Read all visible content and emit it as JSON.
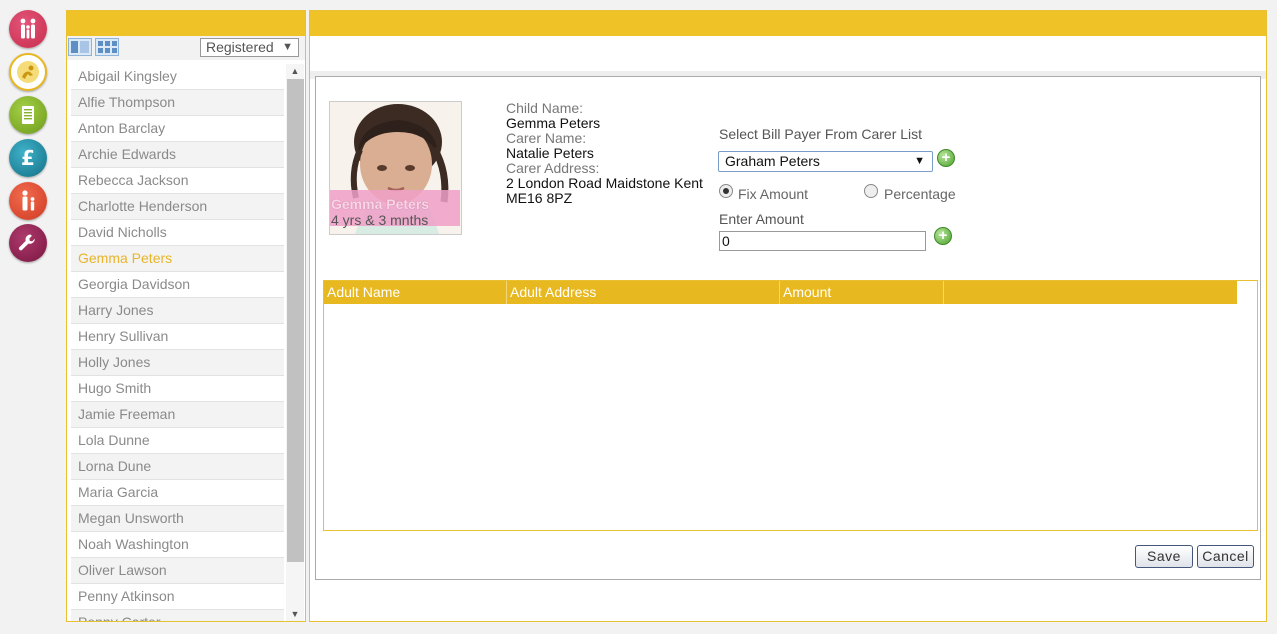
{
  "nav": {
    "icons": [
      "family-icon",
      "child-activity-icon",
      "notes-icon",
      "finance-icon",
      "parent-child-icon",
      "settings-icon"
    ],
    "colors": {
      "family": "#c82d4c",
      "activity": "#e8b820",
      "notes": "#86b12a",
      "finance": "#1b8aa3",
      "parent": "#d9432b",
      "settings": "#8a1f4e"
    }
  },
  "child_list": {
    "filter_value": "Registered",
    "children": [
      "Abigail Kingsley",
      "Alfie Thompson",
      "Anton Barclay",
      "Archie Edwards",
      "Rebecca Jackson",
      "Charlotte Henderson",
      "David Nicholls",
      "Gemma Peters",
      "Georgia Davidson",
      "Harry Jones",
      "Henry Sullivan",
      "Holly Jones",
      "Hugo Smith",
      "Jamie Freeman",
      "Lola Dunne",
      "Lorna Dune",
      "Maria Garcia",
      "Megan Unsworth",
      "Noah Washington",
      "Oliver Lawson",
      "Penny Atkinson",
      "Penny Carter"
    ],
    "selected": "Gemma Peters"
  },
  "child": {
    "photo_name": "Gemma Peters",
    "photo_age": "4 yrs & 3 mnths",
    "child_name_label": "Child Name:",
    "child_name": "Gemma Peters",
    "carer_name_label": "Carer Name:",
    "carer_name": "Natalie Peters",
    "carer_address_label": "Carer Address:",
    "carer_address_line1": "2 London Road Maidstone Kent",
    "carer_address_line2": "ME16 8PZ"
  },
  "bill_payer": {
    "label": "Select Bill Payer From Carer List",
    "selected": "Graham Peters",
    "fix_amount_label": "Fix Amount",
    "percentage_label": "Percentage",
    "mode": "Fix Amount",
    "enter_amount_label": "Enter Amount",
    "amount_value": "0"
  },
  "table": {
    "columns": [
      "Adult Name",
      "Adult Address",
      "Amount",
      ""
    ],
    "rows": []
  },
  "actions": {
    "save_label": "Save",
    "cancel_label": "Cancel"
  },
  "theme": {
    "accent": "#efc227",
    "selected_text": "#e8b52a"
  }
}
